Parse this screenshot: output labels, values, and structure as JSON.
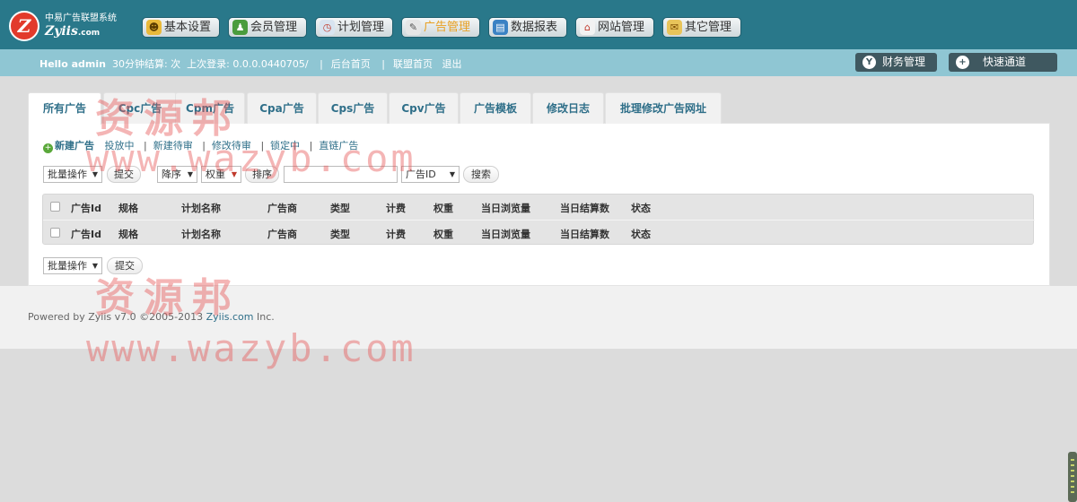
{
  "brand": {
    "name_cn": "中易广告联盟系统",
    "name_en": "Zyiis",
    "name_en_suffix": ".com",
    "logo_letter": "Z"
  },
  "nav": [
    {
      "label": "基本设置",
      "icon": "user-icon"
    },
    {
      "label": "会员管理",
      "icon": "members-icon"
    },
    {
      "label": "计划管理",
      "icon": "clock-icon"
    },
    {
      "label": "广告管理",
      "icon": "ad-icon",
      "active": true
    },
    {
      "label": "数据报表",
      "icon": "chart-icon"
    },
    {
      "label": "网站管理",
      "icon": "house-icon"
    },
    {
      "label": "其它管理",
      "icon": "gift-icon"
    }
  ],
  "subbar": {
    "user": "Hello admin",
    "settle": "30分钟结算: 次",
    "last_login": "上次登录: 0.0.0.0440705/",
    "links": [
      "后台首页",
      "联盟首页",
      "退出"
    ],
    "finance": "财务管理",
    "finance_icon_glyph": "Y",
    "quick": "快速通道",
    "quick_icon_glyph": "+"
  },
  "tabs": [
    "所有广告",
    "Cpc广告",
    "Cpm广告",
    "Cpa广告",
    "Cps广告",
    "Cpv广告",
    "广告模板",
    "修改日志",
    "批理修改广告网址"
  ],
  "sublinks": {
    "new": "新建广告",
    "plus_glyph": "+",
    "items": [
      "投放中",
      "新建待审",
      "修改待审",
      "锁定中",
      "直链广告"
    ]
  },
  "controls": {
    "batch": "批量操作",
    "submit": "提交",
    "order": "降序",
    "weight": "权重",
    "sort": "排序",
    "search_field": "广告ID",
    "search_value": "",
    "search": "搜索",
    "arrow": "▼"
  },
  "table": {
    "columns": [
      "广告Id",
      "规格",
      "计划名称",
      "广告商",
      "类型",
      "计费",
      "权重",
      "当日浏览量",
      "当日结算数",
      "状态"
    ]
  },
  "footer": {
    "prefix": "Powered by Zyiis v7.0 ©2005-2013",
    "link": "Zyiis.com",
    "suffix": "Inc."
  },
  "watermark": {
    "cn": "资源邦",
    "en": "www.wazyb.com"
  }
}
